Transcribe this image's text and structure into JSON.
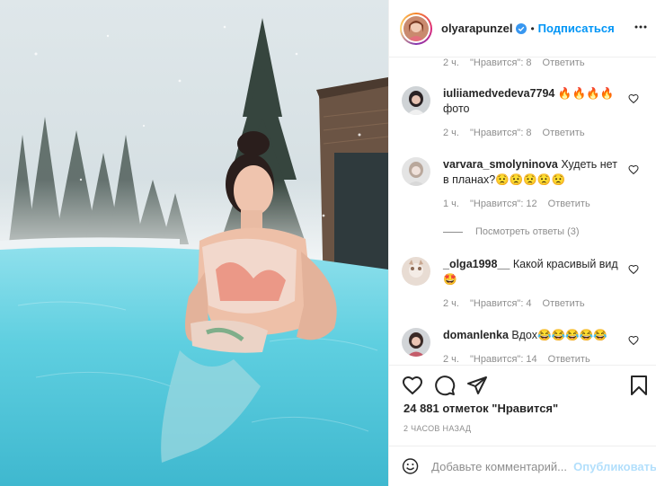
{
  "post": {
    "username": "olyarapunzel",
    "separator": "•",
    "follow_label": "Подписаться"
  },
  "comments_top_meta": {
    "time": "2 ч.",
    "likes": "\"Нравится\": 8",
    "reply": "Ответить"
  },
  "comments": [
    {
      "username": "iuliiamedvedeva7794",
      "text": "🔥🔥🔥🔥 фото",
      "time": "2 ч.",
      "likes": "\"Нравится\": 8",
      "reply": "Ответить"
    },
    {
      "username": "varvara_smolyninova",
      "text": "Худеть нет в планах?😟😟😟😟😟",
      "time": "1 ч.",
      "likes": "\"Нравится\": 12",
      "reply": "Ответить",
      "view_replies": "Посмотреть ответы (3)"
    },
    {
      "username": "_olga1998__",
      "text": "Какой красивый вид 🤩",
      "time": "2 ч.",
      "likes": "\"Нравится\": 4",
      "reply": "Ответить"
    },
    {
      "username": "domanlenka",
      "text": "Вдох😂😂😂😂😂",
      "time": "2 ч.",
      "likes": "\"Нравится\": 14",
      "reply": "Ответить"
    }
  ],
  "likes_count": "24 881 отметок \"Нравится\"",
  "time_ago": "2 ЧАСОВ НАЗАД",
  "comment_box": {
    "placeholder": "Добавьте комментарий...",
    "publish_label": "Опубликовать"
  },
  "colors": {
    "accent": "#0095f6",
    "publish_disabled": "#b2dffc",
    "secondary_text": "#8e8e8e",
    "water": "#4fc6d9"
  },
  "icons": [
    "verified-badge-icon",
    "more-options-icon",
    "heart-icon",
    "comment-icon",
    "share-icon",
    "bookmark-icon",
    "emoji-icon"
  ]
}
